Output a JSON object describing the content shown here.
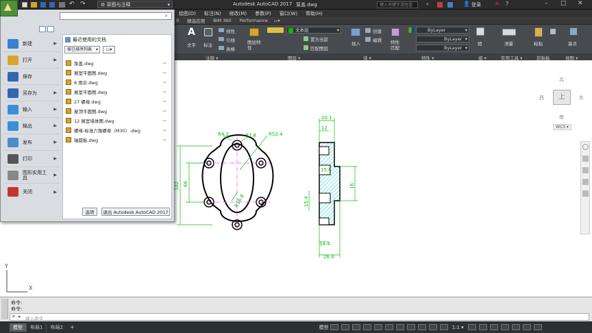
{
  "title_bar": {
    "workspace": "草图与注释",
    "app_title": "Autodesk AutoCAD 2017",
    "file_name": "泵盖.dwg",
    "search_placeholder": "键入关键字或短语",
    "login": "登录"
  },
  "menu": [
    "绘图(D)",
    "标注(N)",
    "修改(M)",
    "参数(P)",
    "窗口(W)",
    "帮助(H)"
  ],
  "ribbon_tabs": [
    "0",
    "精选应用",
    "BIM 360",
    "Performance"
  ],
  "ribbon": {
    "text_btn": "文字",
    "dim_btn": "标注",
    "linear": "线性",
    "leader": "引线",
    "table": "表格",
    "layer_props": "图层特性",
    "layer_name": "文本层",
    "set_current": "置为当前",
    "match_layer": "匹配图层",
    "insert": "插入",
    "create": "创建",
    "edit": "编辑",
    "match_props": "特性匹配",
    "bylayer1": "ByLayer",
    "bylayer2": "ByLayer",
    "bylayer3": "ByLayer",
    "group": "组",
    "measure": "测量",
    "paste": "粘贴",
    "base": "基点"
  },
  "ribbon_panels": [
    "注释 ▾",
    "图层 ▾",
    "块 ▾",
    "特性 ▾",
    "组 ▾",
    "实用工具 ▾",
    "剪贴板",
    "视图 ▾"
  ],
  "app_menu": {
    "search_placeholder": "",
    "left_items": [
      {
        "label": "新建",
        "arrow": "▶",
        "color": "#3c7fd0"
      },
      {
        "label": "打开",
        "arrow": "▶",
        "color": "#d9a431"
      },
      {
        "label": "保存",
        "arrow": "",
        "color": "#3466b0"
      },
      {
        "label": "另存为",
        "arrow": "▶",
        "color": "#3466b0"
      },
      {
        "label": "输入",
        "arrow": "▶",
        "color": "#3a8fd8"
      },
      {
        "label": "输出",
        "arrow": "▶",
        "color": "#3a8fd8"
      },
      {
        "label": "发布",
        "arrow": "▶",
        "color": "#4f8bc9"
      },
      {
        "label": "打印",
        "arrow": "▶",
        "color": "#555"
      },
      {
        "label": "图形实用工具",
        "arrow": "▶",
        "color": "#888"
      },
      {
        "label": "关闭",
        "arrow": "▶",
        "color": "#c0392b"
      }
    ],
    "recent_header": "最近使用的文档",
    "sort_label": "按已排序列表",
    "recent_files": [
      "泵盖.dwg",
      "展室平面图.dwg",
      "8 雨伞.dwg",
      "展室平面图.dwg",
      "27 螺母.dwg",
      "屋顶平面图.dwg",
      "12 展室墙体图.dwg",
      "螺母-标准六角螺母（M30）.dwg",
      "轴旋板.dwg"
    ],
    "options_btn": "选项",
    "exit_btn": "退出 Autodesk AutoCAD 2017"
  },
  "viewcube": {
    "north": "北",
    "south": "南",
    "east": "东",
    "west": "西",
    "top": "上",
    "wcs": "WCS ▾"
  },
  "drawing": {
    "front_labels": [
      "R4.2",
      "R7.8",
      "R52.4",
      "R16.8",
      "R16.8",
      "102",
      "66"
    ],
    "side_labels": [
      "20.1",
      "12",
      "15.6",
      "16",
      "15.4",
      "14.4",
      "26.4"
    ]
  },
  "command": {
    "line1": "命令:",
    "line2": "命令:",
    "placeholder": "键入命令"
  },
  "status": {
    "tabs": [
      "模型",
      "布局1",
      "布局2"
    ],
    "add_tab": "+",
    "model": "模型",
    "scale": "1:1 ▾"
  },
  "colors": {
    "dim": "#00c000",
    "outline": "#000000",
    "hatch": "#00c8c8",
    "center": "#ff40ff",
    "accent": "#2b2b2b"
  }
}
